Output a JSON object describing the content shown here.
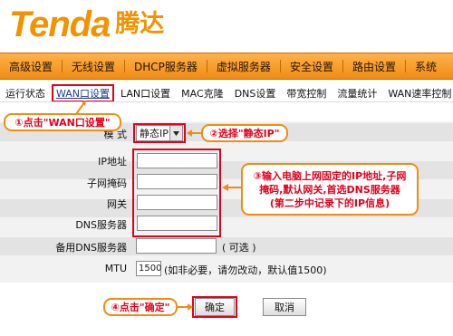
{
  "brand": {
    "name_en": "Tenda",
    "name_cn": "腾达"
  },
  "main_nav": [
    "高级设置",
    "无线设置",
    "DHCP服务器",
    "虚拟服务器",
    "安全设置",
    "路由设置",
    "系统"
  ],
  "sub_nav": [
    "运行状态",
    "WAN口设置",
    "LAN口设置",
    "MAC克隆",
    "DNS设置",
    "带宽控制",
    "流量统计",
    "WAN速率控制"
  ],
  "sub_nav_active_index": 1,
  "annotations": {
    "step1": "①点击\"WAN口设置\"",
    "step2": "②选择\"静态IP\"",
    "step3_lines": [
      "③输入电脑上网固定的IP地址,子网",
      "掩码,默认网关,首选DNS服务器",
      "(第二步中记录下的IP信息)"
    ],
    "step4": "④点击\"确定\""
  },
  "form": {
    "mode_label": "模 式",
    "mode_value": "静态IP",
    "ip_label": "IP地址",
    "mask_label": "子网掩码",
    "gateway_label": "网关",
    "dns_label": "DNS服务器",
    "dns2_label": "备用DNS服务器",
    "dns2_hint": "( 可选 )",
    "mtu_label": "MTU",
    "mtu_value": "1500",
    "mtu_hint": "(如非必要，请勿改动，默认值1500)"
  },
  "buttons": {
    "ok": "确定",
    "cancel": "取消"
  },
  "colors": {
    "brand_orange": "#f39200",
    "annotation_red": "#e3001b",
    "nav_orange": "#f08c14"
  }
}
